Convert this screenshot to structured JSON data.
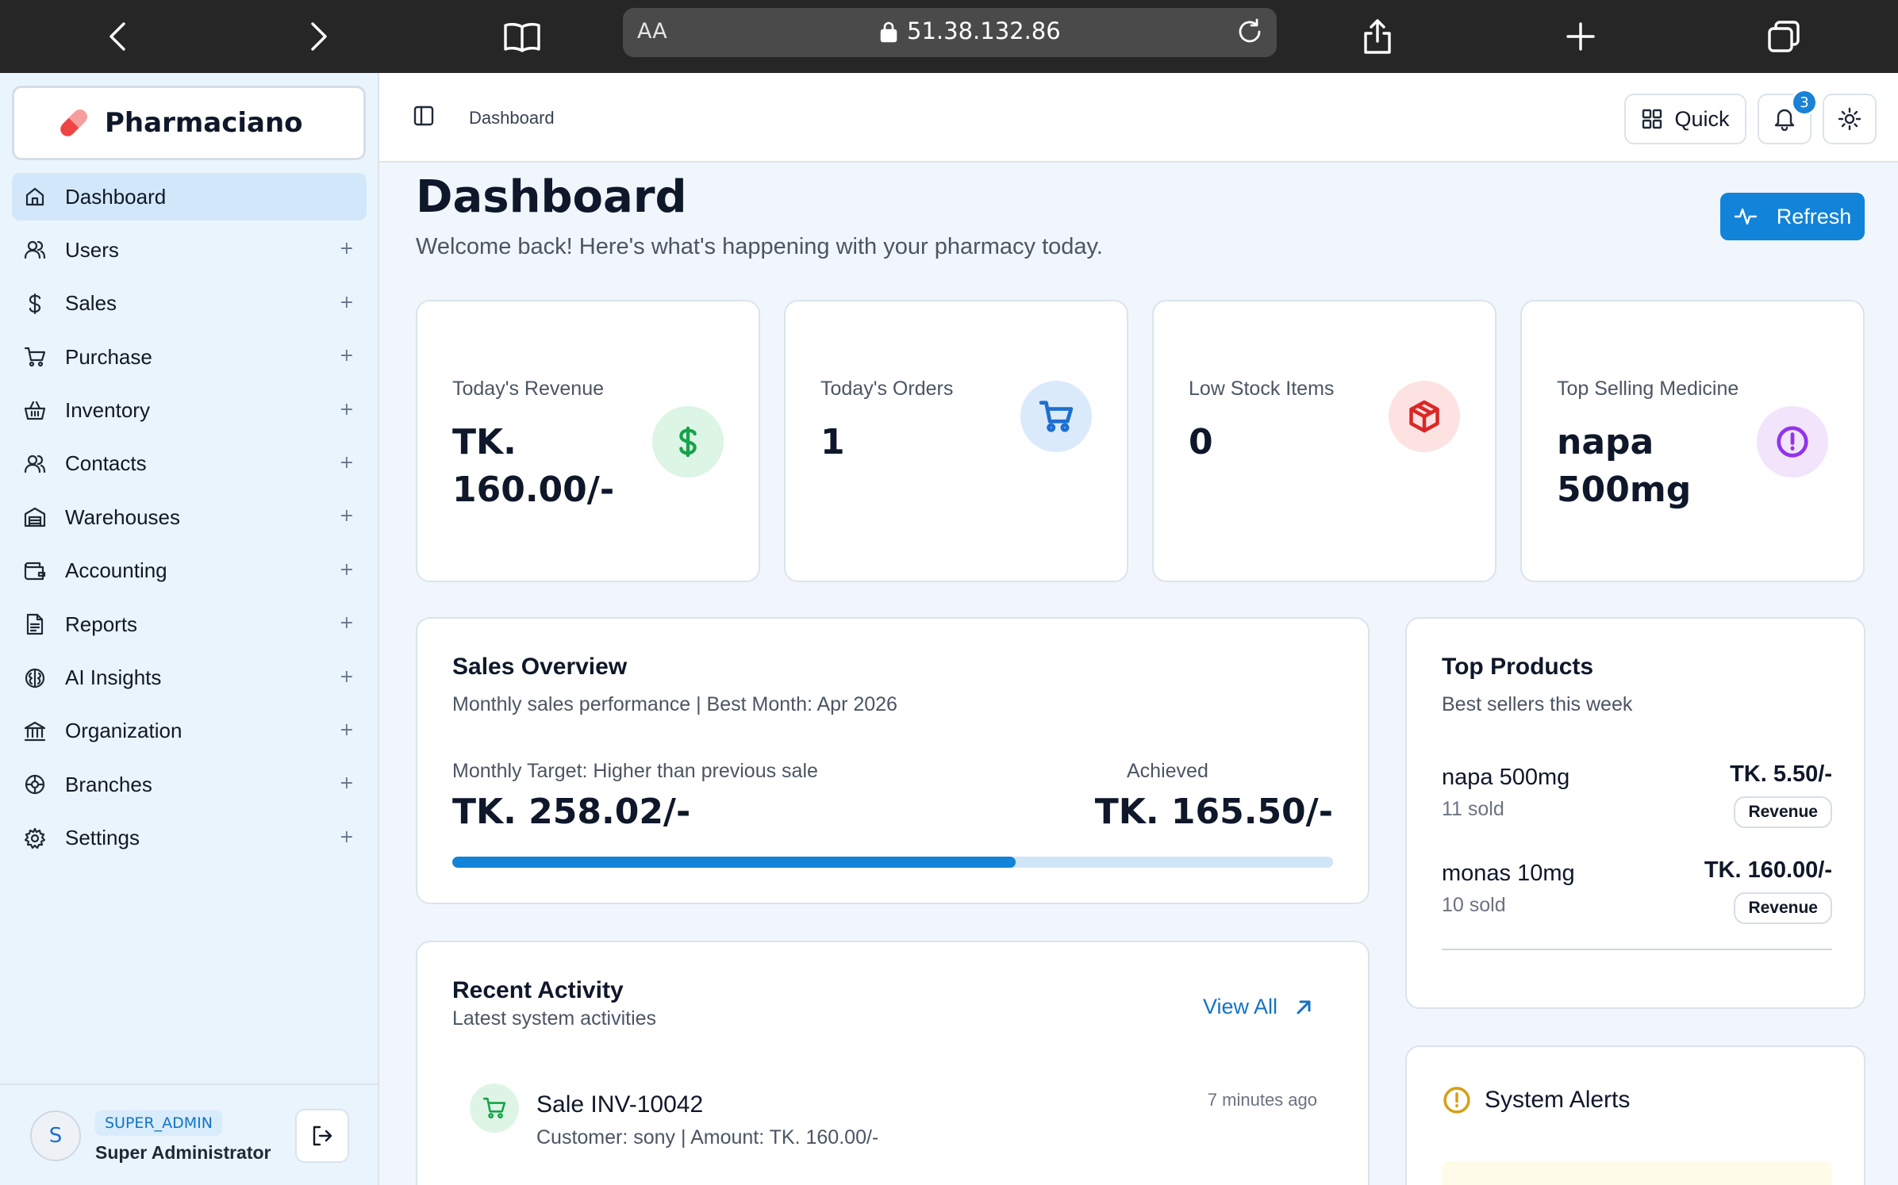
{
  "browser": {
    "aa_label": "AA",
    "url": "51.38.132.86"
  },
  "sidebar": {
    "brand": "Pharmaciano",
    "items": [
      {
        "label": "Dashboard",
        "icon": "home-icon",
        "active": true
      },
      {
        "label": "Users",
        "icon": "users-icon"
      },
      {
        "label": "Sales",
        "icon": "dollar-icon"
      },
      {
        "label": "Purchase",
        "icon": "cart-icon"
      },
      {
        "label": "Inventory",
        "icon": "basket-icon"
      },
      {
        "label": "Contacts",
        "icon": "contacts-icon"
      },
      {
        "label": "Warehouses",
        "icon": "warehouse-icon"
      },
      {
        "label": "Accounting",
        "icon": "wallet-icon"
      },
      {
        "label": "Reports",
        "icon": "report-icon"
      },
      {
        "label": "AI Insights",
        "icon": "brain-icon"
      },
      {
        "label": "Organization",
        "icon": "bank-icon"
      },
      {
        "label": "Branches",
        "icon": "branch-icon"
      },
      {
        "label": "Settings",
        "icon": "gear-icon"
      }
    ],
    "expand_symbol": "+",
    "user": {
      "initial": "S",
      "role": "SUPER_ADMIN",
      "name": "Super Administrator"
    }
  },
  "header": {
    "breadcrumb": "Dashboard",
    "quick_label": "Quick",
    "notification_count": "3"
  },
  "main": {
    "title": "Dashboard",
    "subtitle": "Welcome back! Here's what's happening with your pharmacy today.",
    "refresh_label": "Refresh",
    "stats": [
      {
        "label": "Today's Revenue",
        "value": "TK. 160.00/-",
        "icon": "dollar-icon",
        "color": "#16a34a",
        "bg": "#dcf5e5"
      },
      {
        "label": "Today's Orders",
        "value": "1",
        "icon": "cart-icon",
        "color": "#1d6fd0",
        "bg": "#dbeafb"
      },
      {
        "label": "Low Stock Items",
        "value": "0",
        "icon": "package-icon",
        "color": "#dc2626",
        "bg": "#fde2e2"
      },
      {
        "label": "Top Selling Medicine",
        "value": "napa 500mg",
        "icon": "alert-circle-icon",
        "color": "#9333ea",
        "bg": "#f1e4fb"
      }
    ],
    "sales_overview": {
      "title": "Sales Overview",
      "subtitle": "Monthly sales performance | Best Month: Apr 2026",
      "target_label": "Monthly Target: Higher than previous sale",
      "target_value": "TK. 258.02/-",
      "achieved_label": "Achieved",
      "achieved_value": "TK. 165.50/-",
      "progress_fraction": 0.64
    },
    "top_products": {
      "title": "Top Products",
      "subtitle": "Best sellers this week",
      "items": [
        {
          "name": "napa 500mg",
          "sold": "11 sold",
          "price": "TK. 5.50/-",
          "tag": "Revenue"
        },
        {
          "name": "monas 10mg",
          "sold": "10 sold",
          "price": "TK. 160.00/-",
          "tag": "Revenue"
        }
      ]
    },
    "recent_activity": {
      "title": "Recent Activity",
      "subtitle": "Latest system activities",
      "view_all": "View All",
      "items": [
        {
          "title": "Sale INV-10042",
          "desc": "Customer: sony | Amount: TK. 160.00/-",
          "time": "7 minutes ago"
        }
      ]
    },
    "system_alerts": {
      "title": "System Alerts"
    }
  }
}
